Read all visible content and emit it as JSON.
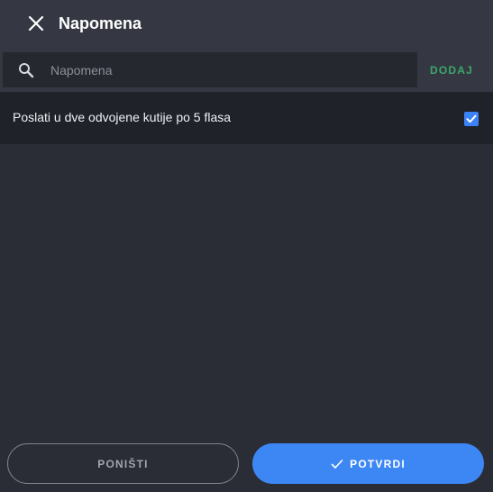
{
  "header": {
    "title": "Napomena",
    "close_icon": "close-icon"
  },
  "search": {
    "placeholder": "Napomena",
    "value": "",
    "icon": "search-icon",
    "add_label": "DODAJ"
  },
  "notes": [
    {
      "text": "Poslati u dve odvojene kutije po 5 flasa",
      "checked": true
    }
  ],
  "footer": {
    "cancel_label": "PONIŠTI",
    "confirm_label": "POTVRDI"
  },
  "colors": {
    "accent": "#3d87f5",
    "add": "#3aa86a",
    "background": "#2b2d36",
    "header": "#353842"
  }
}
